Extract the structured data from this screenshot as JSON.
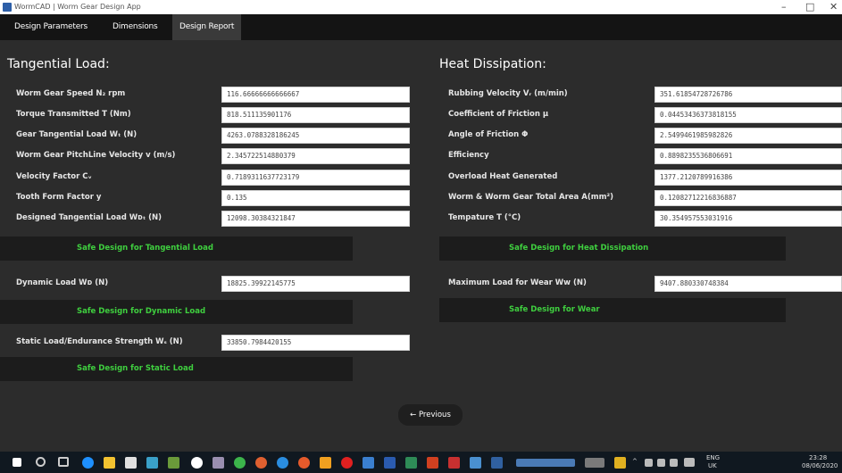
{
  "window": {
    "title": "WormCAD | Worm Gear Design App",
    "minimize": "–",
    "maximize": "□",
    "close": "✕"
  },
  "tabs": [
    {
      "label": "Design Parameters",
      "active": false
    },
    {
      "label": "Dimensions",
      "active": false
    },
    {
      "label": "Design Report",
      "active": true
    }
  ],
  "tangential": {
    "title": "Tangential Load:",
    "rows": [
      {
        "label": "Worm Gear Speed N₂ rpm",
        "value": "116.66666666666667"
      },
      {
        "label": "Torque Transmitted T (Nm)",
        "value": "818.511135901176"
      },
      {
        "label": "Gear Tangential Load Wₜ (N)",
        "value": "4263.0788328186245"
      },
      {
        "label": "Worm Gear PitchLine Velocity v (m/s)",
        "value": "2.345722514880379"
      },
      {
        "label": "Velocity Factor Cᵥ",
        "value": "0.7189311637723179"
      },
      {
        "label": "Tooth Form Factor y",
        "value": "0.135"
      },
      {
        "label": "Designed Tangential Load Wᴅₜ (N)",
        "value": "12098.30384321847"
      }
    ],
    "status": "Safe Design for Tangential Load"
  },
  "dynamic": {
    "label": "Dynamic Load Wᴅ (N)",
    "value": "18825.39922145775",
    "status": "Safe Design for Dynamic Load"
  },
  "static": {
    "label": "Static Load/Endurance Strength Wₛ (N)",
    "value": "33850.7984420155",
    "status": "Safe Design for Static Load"
  },
  "heat": {
    "title": "Heat Dissipation:",
    "rows": [
      {
        "label": "Rubbing Velocity Vᵣ (m/min)",
        "value": "351.61854728726786"
      },
      {
        "label": "Coefficient of Friction μ",
        "value": "0.04453436373818155"
      },
      {
        "label": "Angle of Friction Φ",
        "value": "2.5499461985982826"
      },
      {
        "label": "Efficiency",
        "value": "0.8898235536806691"
      },
      {
        "label": "Overload Heat Generated",
        "value": "1377.2120789916386"
      },
      {
        "label": "Worm & Worm Gear Total Area A(mm²)",
        "value": "0.12082712216836887"
      },
      {
        "label": "Tempature T (°C)",
        "value": "30.354957553031916"
      }
    ],
    "status": "Safe Design for Heat Dissipation"
  },
  "wear": {
    "label": "Maximum Load for Wear Wᴡ (N)",
    "value": "9407.880330748384",
    "status": "Safe Design for Wear"
  },
  "previous_button": "← Previous",
  "taskbar": {
    "lang": "ENG",
    "region": "UK",
    "time": "23:28",
    "date": "08/06/2020"
  },
  "colors": {
    "background": "#2c2c2c",
    "tabbar": "#141414",
    "status_text": "#3fcf3f",
    "status_bg": "#1c1c1c"
  }
}
